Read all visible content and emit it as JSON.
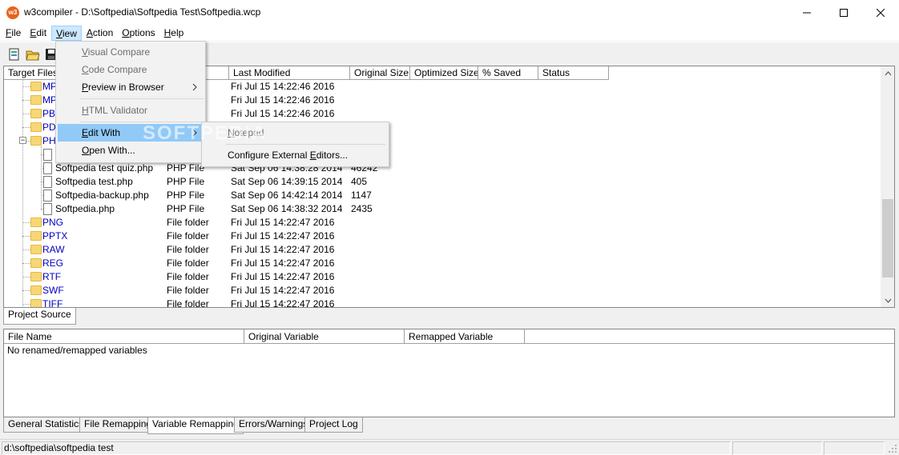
{
  "window": {
    "title": "w3compiler - D:\\Softpedia\\Softpedia Test\\Softpedia.wcp",
    "icon_text": "w3"
  },
  "menubar": {
    "items": [
      {
        "label": "File",
        "accel": "F",
        "rest": "ile"
      },
      {
        "label": "Edit",
        "accel": "E",
        "rest": "dit"
      },
      {
        "label": "View",
        "accel": "V",
        "rest": "iew"
      },
      {
        "label": "Action",
        "accel": "A",
        "rest": "ction"
      },
      {
        "label": "Options",
        "accel": "O",
        "rest": "ptions"
      },
      {
        "label": "Help",
        "accel": "H",
        "rest": "elp"
      }
    ]
  },
  "columns": [
    "Target Files",
    "",
    "Last Modified",
    "Original Size",
    "Optimized Size",
    "% Saved",
    "Status"
  ],
  "rows": [
    {
      "name": "MP",
      "kind": "folder",
      "type": "",
      "modified": "Fri Jul 15 14:22:46 2016",
      "size": ""
    },
    {
      "name": "MP",
      "kind": "folder",
      "type": "",
      "modified": "Fri Jul 15 14:22:46 2016",
      "size": ""
    },
    {
      "name": "PB",
      "kind": "folder",
      "type": "",
      "modified": "Fri Jul 15 14:22:46 2016",
      "size": ""
    },
    {
      "name": "PD",
      "kind": "folder",
      "type": "",
      "modified": "",
      "size": ""
    },
    {
      "name": "PH",
      "kind": "folder",
      "type": "",
      "modified": "",
      "size": ""
    },
    {
      "name": "",
      "kind": "file",
      "type": "",
      "modified": "",
      "size": ""
    },
    {
      "name": "Softpedia test quiz.php",
      "kind": "file",
      "type": "PHP File",
      "modified": "Sat Sep 06 14:38:28 2014",
      "size": "46242"
    },
    {
      "name": "Softpedia test.php",
      "kind": "file",
      "type": "PHP File",
      "modified": "Sat Sep 06 14:39:15 2014",
      "size": "405"
    },
    {
      "name": "Softpedia-backup.php",
      "kind": "file",
      "type": "PHP File",
      "modified": "Sat Sep 06 14:42:14 2014",
      "size": "1147"
    },
    {
      "name": "Softpedia.php",
      "kind": "file",
      "type": "PHP File",
      "modified": "Sat Sep 06 14:38:32 2014",
      "size": "2435"
    },
    {
      "name": "PNG",
      "kind": "folder",
      "type": "File folder",
      "modified": "Fri Jul 15 14:22:47 2016",
      "size": ""
    },
    {
      "name": "PPTX",
      "kind": "folder",
      "type": "File folder",
      "modified": "Fri Jul 15 14:22:47 2016",
      "size": ""
    },
    {
      "name": "RAW",
      "kind": "folder",
      "type": "File folder",
      "modified": "Fri Jul 15 14:22:47 2016",
      "size": ""
    },
    {
      "name": "REG",
      "kind": "folder",
      "type": "File folder",
      "modified": "Fri Jul 15 14:22:47 2016",
      "size": ""
    },
    {
      "name": "RTF",
      "kind": "folder",
      "type": "File folder",
      "modified": "Fri Jul 15 14:22:47 2016",
      "size": ""
    },
    {
      "name": "SWF",
      "kind": "folder",
      "type": "File folder",
      "modified": "Fri Jul 15 14:22:47 2016",
      "size": ""
    },
    {
      "name": "TIFF",
      "kind": "folder",
      "type": "File folder",
      "modified": "Fri Jul 15 14:22:47 2016",
      "size": ""
    }
  ],
  "upper_tab": "Project Source",
  "lower": {
    "columns": [
      "File Name",
      "Original Variable",
      "Remapped Variable"
    ],
    "message": "No renamed/remapped variables"
  },
  "bottom_tabs": [
    "General Statistics",
    "File Remapping",
    "Variable Remapping",
    "Errors/Warnings",
    "Project Log"
  ],
  "status": {
    "path": "d:\\softpedia\\softpedia test"
  },
  "view_menu": {
    "items": [
      {
        "label": "Visual Compare",
        "accel": "V",
        "rest": "isual Compare",
        "disabled": true
      },
      {
        "label": "Code Compare",
        "accel": "C",
        "rest": "ode Compare",
        "disabled": true
      },
      {
        "label": "Preview in Browser",
        "accel": "P",
        "rest": "review in Browser",
        "disabled": false,
        "submenu": true
      },
      {
        "label": "HTML Validator",
        "accel": "H",
        "rest": "TML Validator",
        "disabled": true
      },
      {
        "label": "Edit With",
        "accel": "E",
        "rest": "dit With",
        "disabled": false,
        "submenu": true
      },
      {
        "label": "Open With...",
        "accel": "O",
        "rest": "pen With...",
        "disabled": false
      }
    ]
  },
  "edit_with_menu": {
    "items": [
      {
        "label": "Notepad",
        "accel": "N",
        "rest": "otepad",
        "disabled": true
      },
      {
        "label": "Configure External Editors...",
        "pre": "Configure External ",
        "accel": "E",
        "rest": "ditors...",
        "disabled": false
      }
    ]
  },
  "watermark": "SOFTPEDIA",
  "colors": {
    "folder_text": "#0000c0",
    "highlight": "#91c9f7",
    "menu_active": "#cce8ff"
  }
}
